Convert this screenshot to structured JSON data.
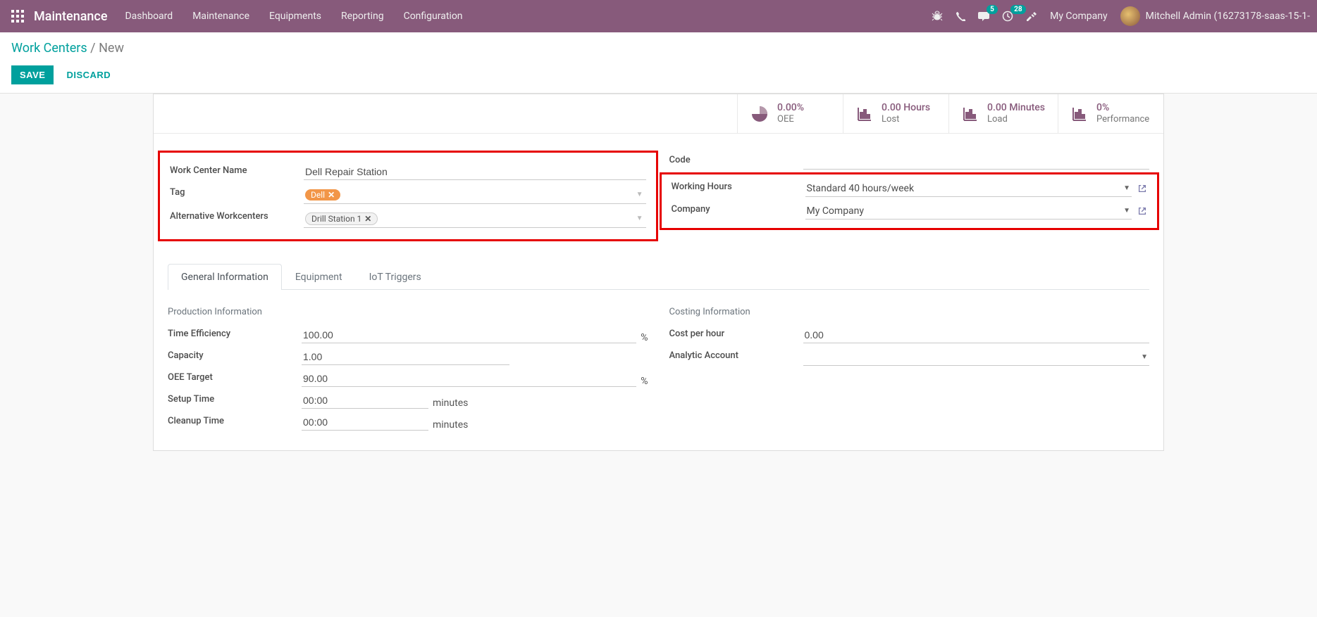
{
  "nav": {
    "brand": "Maintenance",
    "menu": [
      "Dashboard",
      "Maintenance",
      "Equipments",
      "Reporting",
      "Configuration"
    ],
    "msg_badge": "5",
    "activity_badge": "28",
    "company": "My Company",
    "user": "Mitchell Admin (16273178-saas-15-1-"
  },
  "breadcrumb": {
    "parent": "Work Centers",
    "current": "New"
  },
  "buttons": {
    "save": "SAVE",
    "discard": "DISCARD"
  },
  "stats": {
    "oee": {
      "value": "0.00%",
      "label": "OEE"
    },
    "lost": {
      "value": "0.00 Hours",
      "label": "Lost"
    },
    "load": {
      "value": "0.00 Minutes",
      "label": "Load"
    },
    "perf": {
      "value": "0%",
      "label": "Performance"
    }
  },
  "fields": {
    "name_label": "Work Center Name",
    "name_value": "Dell Repair Station",
    "tag_label": "Tag",
    "tag_items": [
      {
        "name": "Dell"
      }
    ],
    "alt_label": "Alternative Workcenters",
    "alt_items": [
      {
        "name": "Drill Station 1"
      }
    ],
    "code_label": "Code",
    "wh_label": "Working Hours",
    "wh_value": "Standard 40 hours/week",
    "company_label": "Company",
    "company_value": "My Company"
  },
  "tabs": {
    "t1": "General Information",
    "t2": "Equipment",
    "t3": "IoT Triggers"
  },
  "sections": {
    "prod_title": "Production Information",
    "cost_title": "Costing Information",
    "eff_label": "Time Efficiency",
    "eff_value": "100.00",
    "eff_unit": "%",
    "cap_label": "Capacity",
    "cap_value": "1.00",
    "oee_label": "OEE Target",
    "oee_value": "90.00",
    "oee_unit": "%",
    "setup_label": "Setup Time",
    "setup_value": "00:00",
    "setup_unit": "minutes",
    "clean_label": "Cleanup Time",
    "clean_value": "00:00",
    "clean_unit": "minutes",
    "cph_label": "Cost per hour",
    "cph_value": "0.00",
    "ana_label": "Analytic Account",
    "ana_value": ""
  }
}
